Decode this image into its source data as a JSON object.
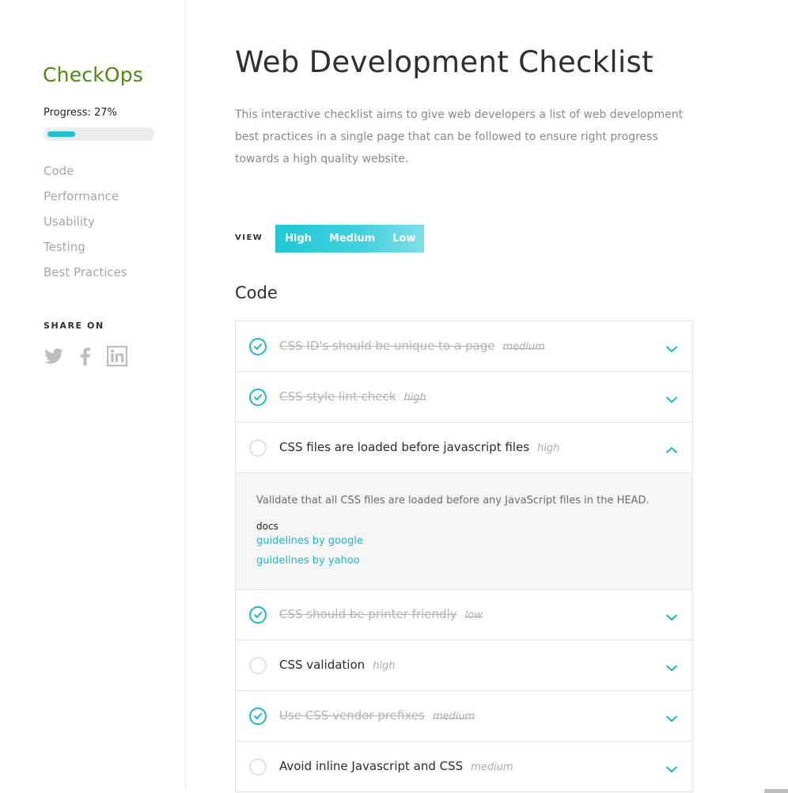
{
  "app": {
    "brand": "CheckOps"
  },
  "progress": {
    "label": "Progress: 27%",
    "value_percent": 27
  },
  "sidebar": {
    "nav": [
      "Code",
      "Performance",
      "Usability",
      "Testing",
      "Best Practices"
    ],
    "share_title": "SHARE ON",
    "share_icons": [
      "twitter-icon",
      "facebook-icon",
      "linkedin-icon"
    ]
  },
  "page": {
    "title": "Web Development Checklist",
    "intro": "This interactive checklist aims to give web developers a list of web development best practices in a single page that can be followed to ensure right progress towards a high quality website."
  },
  "view": {
    "label": "VIEW",
    "options": [
      "High",
      "Medium",
      "Low"
    ]
  },
  "section": {
    "title": "Code"
  },
  "items": [
    {
      "title": "CSS ID's should be unique to a page",
      "priority": "medium",
      "done": true,
      "expanded": false
    },
    {
      "title": "CSS style lint check",
      "priority": "high",
      "done": true,
      "expanded": false
    },
    {
      "title": "CSS files are loaded before javascript files",
      "priority": "high",
      "done": false,
      "expanded": true
    },
    {
      "title": "CSS should be printer friendly",
      "priority": "low",
      "done": true,
      "expanded": false
    },
    {
      "title": "CSS validation",
      "priority": "high",
      "done": false,
      "expanded": false
    },
    {
      "title": "Use CSS vendor prefixes",
      "priority": "medium",
      "done": true,
      "expanded": false
    },
    {
      "title": "Avoid inline Javascript and CSS",
      "priority": "medium",
      "done": false,
      "expanded": false
    }
  ],
  "detail": {
    "text": "Validate that all CSS files are loaded before any JavaScript files in the HEAD.",
    "docs_label": "docs",
    "links": [
      "guidelines by google",
      "guidelines by yahoo"
    ]
  },
  "colors": {
    "accent": "#25c0cf",
    "brand": "#4f8a10"
  }
}
